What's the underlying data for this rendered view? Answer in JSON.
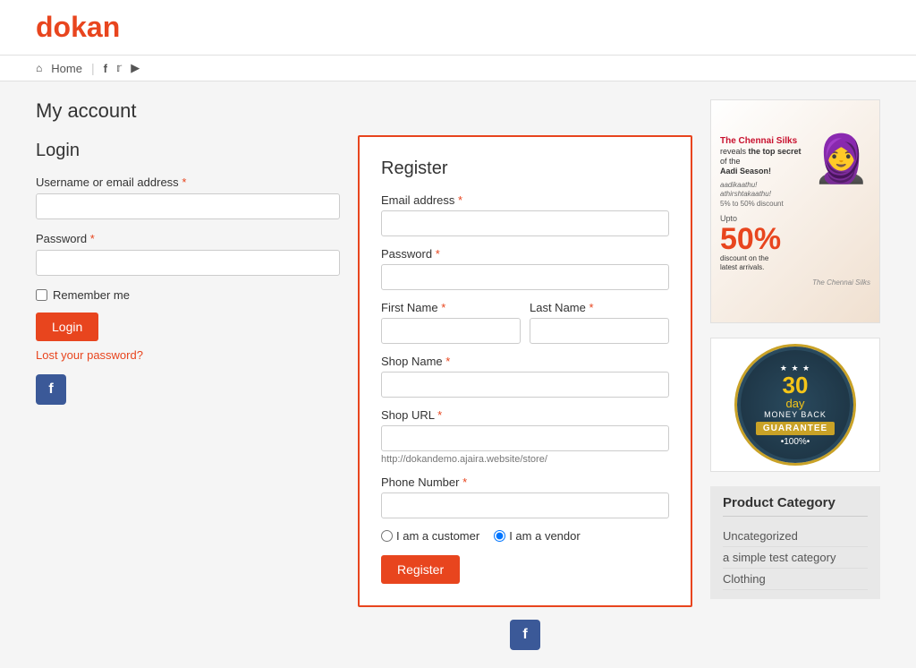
{
  "header": {
    "logo_d": "d",
    "logo_rest": "okan",
    "nav": {
      "home": "Home",
      "facebook_icon": "f",
      "twitter_icon": "t",
      "youtube_icon": "yt"
    }
  },
  "page": {
    "title": "My account"
  },
  "login": {
    "section_title": "Login",
    "username_label": "Username or email address",
    "password_label": "Password",
    "remember_label": "Remember me",
    "login_button": "Login",
    "lost_password": "Lost your password?",
    "required_marker": "*"
  },
  "register": {
    "section_title": "Register",
    "email_label": "Email address",
    "email_required": "*",
    "password_label": "Password",
    "password_required": "*",
    "first_name_label": "First Name",
    "first_name_required": "*",
    "last_name_label": "Last Name",
    "last_name_required": "*",
    "shop_name_label": "Shop Name",
    "shop_name_required": "*",
    "shop_url_label": "Shop URL",
    "shop_url_required": "*",
    "shop_url_hint": "http://dokandemo.ajaira.website/store/",
    "phone_label": "Phone Number",
    "phone_required": "*",
    "customer_label": "I am a customer",
    "vendor_label": "I am a vendor",
    "register_button": "Register"
  },
  "ad": {
    "title_line1": "The Chennai Silks",
    "title_line2": "reveals",
    "title_line3": "the top secret",
    "title_line4": "of the",
    "title_line5": "Aadi Season!",
    "discount": "50%",
    "discount_label": "discount on the latest arrivals.",
    "brand": "The Chennai Silks"
  },
  "guarantee": {
    "days": "30",
    "day_label": "day",
    "money": "MONEY BACK",
    "guarantee_label": "GUARANTEE",
    "pct": "•100%•"
  },
  "sidebar": {
    "product_category_title": "Product Category",
    "categories": [
      {
        "name": "Uncategorized"
      },
      {
        "name": "a simple test category"
      },
      {
        "name": "Clothing"
      }
    ]
  }
}
